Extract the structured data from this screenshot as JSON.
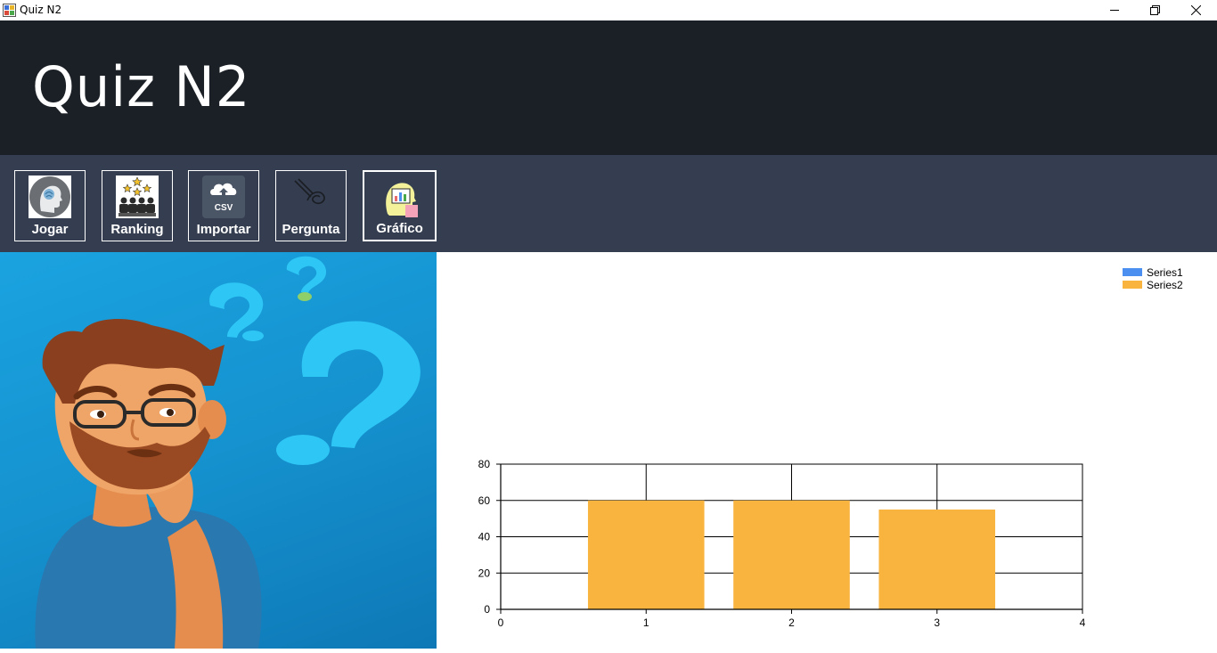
{
  "window": {
    "title": "Quiz N2"
  },
  "header": {
    "title": "Quiz N2"
  },
  "toolbar": {
    "buttons": [
      {
        "label": "Jogar",
        "icon": "brain-head-icon"
      },
      {
        "label": "Ranking",
        "icon": "ranking-stars-icon"
      },
      {
        "label": "Importar",
        "icon": "csv-upload-icon"
      },
      {
        "label": "Pergunta",
        "icon": "pen-scribble-icon"
      },
      {
        "label": "Gráfico",
        "icon": "chart-head-icon"
      }
    ]
  },
  "colors": {
    "header_bg": "#1b2026",
    "toolbar_bg": "#343e50",
    "series1": "#4b8ff0",
    "series2": "#f9b33f"
  },
  "chart_data": {
    "type": "bar",
    "x": [
      1,
      2,
      3
    ],
    "xlim": [
      0,
      4
    ],
    "xticks": [
      "0",
      "1",
      "2",
      "3",
      "4"
    ],
    "ylim": [
      0,
      80
    ],
    "yticks": [
      "0",
      "20",
      "40",
      "60",
      "80"
    ],
    "grid": true,
    "legend": "top-right",
    "series": [
      {
        "name": "Series1",
        "values": [],
        "color": "#4b8ff0"
      },
      {
        "name": "Series2",
        "values": [
          60,
          60,
          55
        ],
        "color": "#f9b33f"
      }
    ]
  }
}
